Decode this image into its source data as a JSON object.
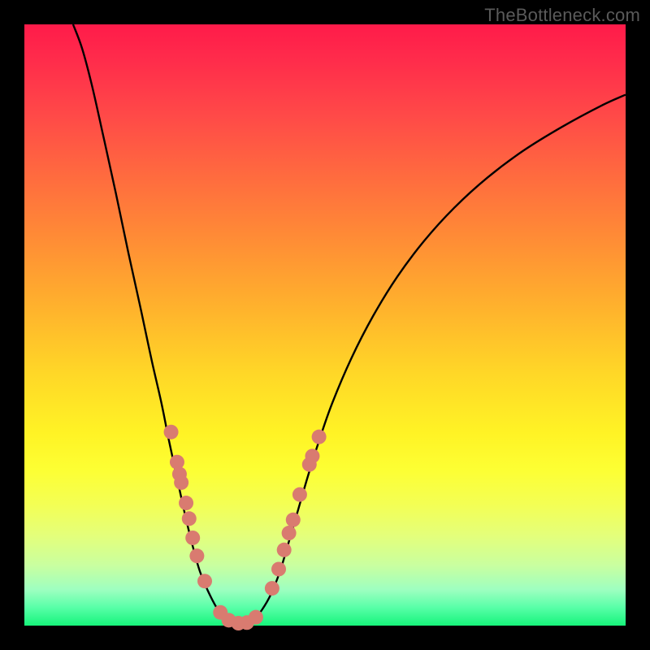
{
  "attribution": "TheBottleneck.com",
  "colors": {
    "bg": "#000000",
    "dot": "#d97b70",
    "curve": "#000000",
    "gradient_top": "#ff1b4a",
    "gradient_bottom": "#16f47a"
  },
  "chart_data": {
    "type": "line",
    "title": "",
    "xlabel": "",
    "ylabel": "",
    "xlim": [
      0,
      100
    ],
    "ylim": [
      0,
      100
    ],
    "note": "x and y are percentages of the inner plot area (0=left/top, 100=right/bottom). Curve is a V-shaped bottleneck profile.",
    "curve_points": [
      [
        8.1,
        0.0
      ],
      [
        9.6,
        4.0
      ],
      [
        11.2,
        10.0
      ],
      [
        13.0,
        18.0
      ],
      [
        15.2,
        28.0
      ],
      [
        17.3,
        38.0
      ],
      [
        19.5,
        48.0
      ],
      [
        21.2,
        56.0
      ],
      [
        22.8,
        63.0
      ],
      [
        24.0,
        69.0
      ],
      [
        25.3,
        75.0
      ],
      [
        26.6,
        81.0
      ],
      [
        27.8,
        86.0
      ],
      [
        29.2,
        91.0
      ],
      [
        30.9,
        95.0
      ],
      [
        32.5,
        97.8
      ],
      [
        34.0,
        99.1
      ],
      [
        35.5,
        99.6
      ],
      [
        37.0,
        99.5
      ],
      [
        38.3,
        98.8
      ],
      [
        39.5,
        97.4
      ],
      [
        41.0,
        94.8
      ],
      [
        42.5,
        91.0
      ],
      [
        44.0,
        86.0
      ],
      [
        45.6,
        80.5
      ],
      [
        47.2,
        75.0
      ],
      [
        49.0,
        69.3
      ],
      [
        51.2,
        63.0
      ],
      [
        54.4,
        55.5
      ],
      [
        58.0,
        48.5
      ],
      [
        62.0,
        42.0
      ],
      [
        66.5,
        36.0
      ],
      [
        71.5,
        30.5
      ],
      [
        77.0,
        25.5
      ],
      [
        83.0,
        21.0
      ],
      [
        89.5,
        17.0
      ],
      [
        96.0,
        13.5
      ],
      [
        100.0,
        11.7
      ]
    ],
    "dots": [
      [
        24.4,
        67.8
      ],
      [
        25.4,
        72.8
      ],
      [
        25.8,
        74.8
      ],
      [
        26.1,
        76.2
      ],
      [
        26.9,
        79.6
      ],
      [
        27.4,
        82.2
      ],
      [
        28.0,
        85.4
      ],
      [
        28.7,
        88.4
      ],
      [
        30.0,
        92.6
      ],
      [
        32.6,
        97.8
      ],
      [
        34.0,
        99.1
      ],
      [
        35.6,
        99.6
      ],
      [
        37.0,
        99.5
      ],
      [
        38.5,
        98.6
      ],
      [
        41.2,
        93.8
      ],
      [
        42.3,
        90.6
      ],
      [
        43.2,
        87.4
      ],
      [
        44.0,
        84.6
      ],
      [
        44.7,
        82.4
      ],
      [
        45.8,
        78.2
      ],
      [
        47.4,
        73.2
      ],
      [
        47.9,
        71.8
      ],
      [
        49.0,
        68.6
      ]
    ]
  }
}
